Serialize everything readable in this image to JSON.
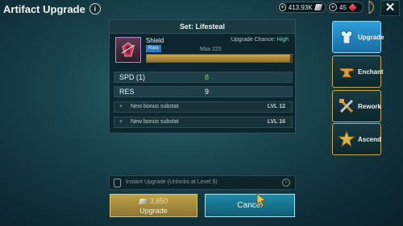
{
  "header": {
    "title": "Artifact Upgrade",
    "info": "i",
    "silver_amount": "413.93K",
    "gems_amount": "45",
    "close": "✕"
  },
  "artifact": {
    "set_title": "Set: Lifesteal",
    "name": "Shield",
    "rarity": "Rare",
    "chance_label": "Upgrade Chance:",
    "chance_value": "High",
    "max_label": "Max 225",
    "level_fill_fraction": 0.99
  },
  "stats": [
    {
      "label": "SPD (1)",
      "value": "8"
    },
    {
      "label": "RES",
      "value": "9"
    }
  ],
  "substats": [
    {
      "plus": "+",
      "label": "New bonus substat",
      "level": "LVL 12"
    },
    {
      "plus": "+",
      "label": "New bonus substat",
      "level": "LVL 16"
    }
  ],
  "side_nav": [
    {
      "label": "Upgrade",
      "icon": "armor-icon",
      "active": true
    },
    {
      "label": "Enchant",
      "icon": "anvil-icon",
      "active": false
    },
    {
      "label": "Rework",
      "icon": "hammer-wrench-icon",
      "active": false
    },
    {
      "label": "Ascend",
      "icon": "ascend-star-icon",
      "active": false
    }
  ],
  "instant_upgrade": {
    "text": "Instant Upgrade (Unlocks at Level 5)",
    "info": "i"
  },
  "actions": {
    "upgrade_cost": "3,850",
    "upgrade_label": "Upgrade",
    "cancel_label": "Cancel"
  },
  "colors": {
    "accent_blue": "#2d9fd8",
    "gold_border": "#c9a94e",
    "chance_high": "#6fe0c8",
    "stat_green": "#7ed957"
  }
}
